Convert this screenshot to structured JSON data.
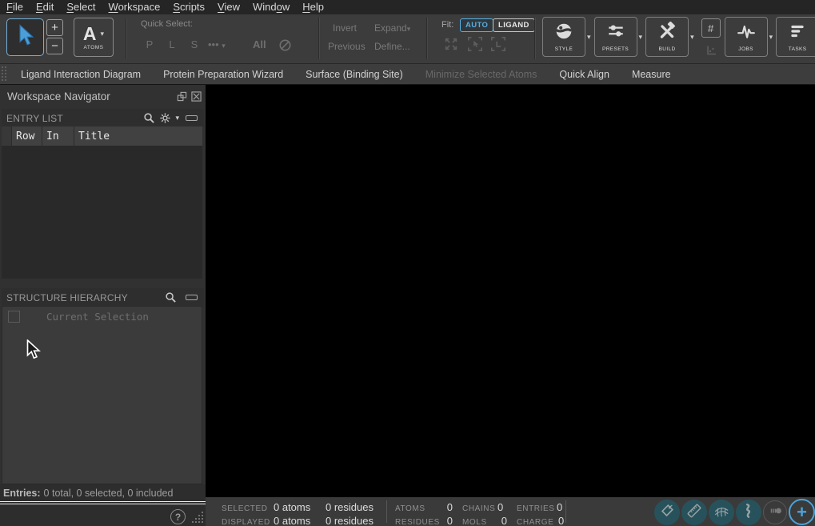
{
  "menubar": {
    "items": [
      {
        "pre": "",
        "accel": "F",
        "post": "ile"
      },
      {
        "pre": "",
        "accel": "E",
        "post": "dit"
      },
      {
        "pre": "",
        "accel": "S",
        "post": "elect"
      },
      {
        "pre": "",
        "accel": "W",
        "post": "orkspace"
      },
      {
        "pre": "",
        "accel": "S",
        "post": "cripts"
      },
      {
        "pre": "",
        "accel": "V",
        "post": "iew"
      },
      {
        "pre": "Wind",
        "accel": "o",
        "post": "w"
      },
      {
        "pre": "",
        "accel": "H",
        "post": "elp"
      }
    ]
  },
  "toolbar": {
    "plus": "+",
    "minus": "−",
    "atoms": {
      "letter": "A",
      "label": "ATOMS"
    },
    "quick_select": {
      "label": "Quick Select:",
      "protein": "P",
      "ligand": "L",
      "solvent": "S",
      "more": "•••",
      "all": "All"
    },
    "selection": {
      "invert": "Invert",
      "previous": "Previous",
      "expand": "Expand",
      "define": "Define..."
    },
    "fit": {
      "label": "Fit:",
      "auto": "AUTO",
      "ligand": "LIGAND"
    },
    "grid": "#",
    "groups": {
      "style": "STYLE",
      "presets": "PRESETS",
      "build": "BUILD",
      "jobs": "JOBS",
      "tasks": "TASKS"
    },
    "caret": "▾"
  },
  "favorites": {
    "items": [
      {
        "label": "Ligand Interaction Diagram",
        "cls": ""
      },
      {
        "label": "Protein Preparation Wizard",
        "cls": ""
      },
      {
        "label": "Surface (Binding Site)",
        "cls": ""
      },
      {
        "label": "Minimize Selected Atoms",
        "cls": "disabled"
      },
      {
        "label": "Quick Align",
        "cls": ""
      },
      {
        "label": "Measure",
        "cls": ""
      }
    ]
  },
  "navigator": {
    "title": "Workspace Navigator",
    "entry_list": {
      "title": "ENTRY LIST",
      "columns": [
        "Row",
        "In",
        "Title"
      ]
    },
    "structure_hierarchy": {
      "title": "STRUCTURE HIERARCHY",
      "current_selection": "Current Selection"
    },
    "entries_summary": {
      "label": "Entries:",
      "text": "0 total, 0 selected, 0 included"
    },
    "help_glyph": "?"
  },
  "status_bar": {
    "selected": {
      "label": "SELECTED",
      "atoms": "0 atoms",
      "residues": "0 residues"
    },
    "displayed": {
      "label": "DISPLAYED",
      "atoms": "0 atoms",
      "residues": "0 residues"
    },
    "counts": {
      "atoms": {
        "label": "ATOMS",
        "value": "0"
      },
      "chains": {
        "label": "CHAINS",
        "value": "0"
      },
      "entries": {
        "label": "ENTRIES",
        "value": "0"
      },
      "residues": {
        "label": "RESIDUES",
        "value": "0"
      },
      "mols": {
        "label": "MOLS",
        "value": "0"
      },
      "charge": {
        "label": "CHARGE",
        "value": "0"
      }
    },
    "plus": "+"
  },
  "colors": {
    "accent_blue": "#4aa3da",
    "fit_auto_blue": "#57aede",
    "teal_button": "#27525c",
    "canvas": "#000000"
  }
}
